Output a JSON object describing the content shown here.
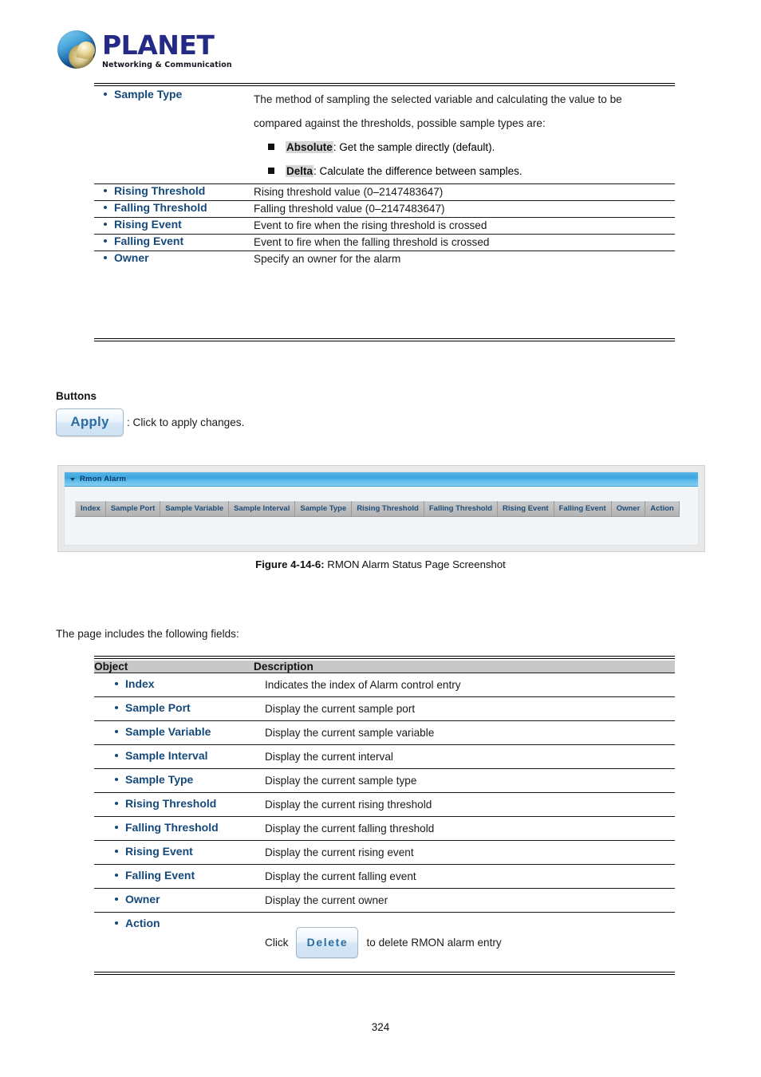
{
  "logo": {
    "brand": "PLANET",
    "tagline": "Networking & Communication"
  },
  "top_table": {
    "rows": [
      {
        "object": "Sample Type",
        "lines": [
          "The method of sampling the selected variable and calculating the value to be",
          "compared against the thresholds, possible sample types are:"
        ],
        "sub_items": [
          {
            "label": "Absolute",
            "text": ": Get the sample directly (default)."
          },
          {
            "label": "Delta",
            "text": ": Calculate the difference between samples."
          }
        ]
      },
      {
        "object": "Rising Threshold",
        "description": "Rising threshold value (0–2147483647)"
      },
      {
        "object": "Falling Threshold",
        "description": "Falling threshold value (0–2147483647)"
      },
      {
        "object": "Rising Event",
        "description": "Event to fire when the rising threshold is crossed"
      },
      {
        "object": "Falling Event",
        "description": "Event to fire when the falling threshold is crossed"
      },
      {
        "object": "Owner",
        "description": "Specify an owner for the alarm"
      }
    ]
  },
  "buttons_section": {
    "heading": "Buttons",
    "apply_label": "Apply",
    "apply_caption": ": Click to apply changes."
  },
  "screenshot": {
    "panel_title": "Rmon Alarm",
    "caret_icon": "chevron-down-icon",
    "table_headers": [
      "Index",
      "Sample Port",
      "Sample Variable",
      "Sample Interval",
      "Sample Type",
      "Rising Threshold",
      "Falling Threshold",
      "Rising Event",
      "Falling Event",
      "Owner",
      "Action"
    ]
  },
  "figure_caption": {
    "label": "Figure 4-14-6:",
    "text": " RMON Alarm Status Page Screenshot"
  },
  "intro_text": "The page includes the following fields:",
  "bottom_table": {
    "headers": {
      "object": "Object",
      "description": "Description"
    },
    "rows": [
      {
        "object": "Index",
        "description": "Indicates the index of Alarm control entry"
      },
      {
        "object": "Sample Port",
        "description": "Display the current sample port"
      },
      {
        "object": "Sample Variable",
        "description": "Display the current sample variable"
      },
      {
        "object": "Sample Interval",
        "description": "Display the current interval"
      },
      {
        "object": "Sample Type",
        "description": "Display the current sample type"
      },
      {
        "object": "Rising Threshold",
        "description": "Display the current rising threshold"
      },
      {
        "object": "Falling Threshold",
        "description": "Display the current falling threshold"
      },
      {
        "object": "Rising Event",
        "description": "Display the current rising event"
      },
      {
        "object": "Falling Event",
        "description": "Display the current falling event"
      },
      {
        "object": "Owner",
        "description": "Display the current owner"
      }
    ],
    "action_row": {
      "object": "Action",
      "click_prefix": "Click",
      "delete_label": "Delete",
      "click_suffix": "to delete RMON alarm entry"
    }
  },
  "page_number": "324",
  "colors": {
    "object_link": "#15497a",
    "header_gray": "#c8c8c8",
    "panel_blue": "#3aa6e0",
    "button_blue": "#2b6ca3"
  }
}
